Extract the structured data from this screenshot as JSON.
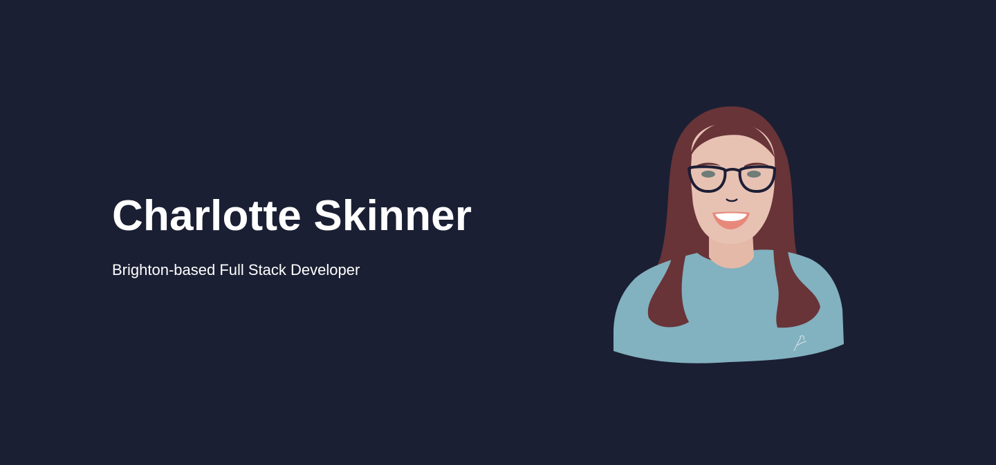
{
  "page": {
    "background_color": "#1b1f33",
    "text_color": "#ffffff"
  },
  "hero": {
    "name": "Charlotte Skinner",
    "tagline": "Brighton-based Full Stack Developer"
  },
  "portrait": {
    "subject": "illustrated-avatar",
    "colors": {
      "hair": "#683438",
      "skin": "#e7c2b3",
      "neck": "#e4b9a8",
      "shirt": "#82b1bf",
      "glasses": "#1e1d35",
      "eyes": "#6f7c78",
      "lips": "#e7887b",
      "teeth": "#ffffff"
    }
  }
}
